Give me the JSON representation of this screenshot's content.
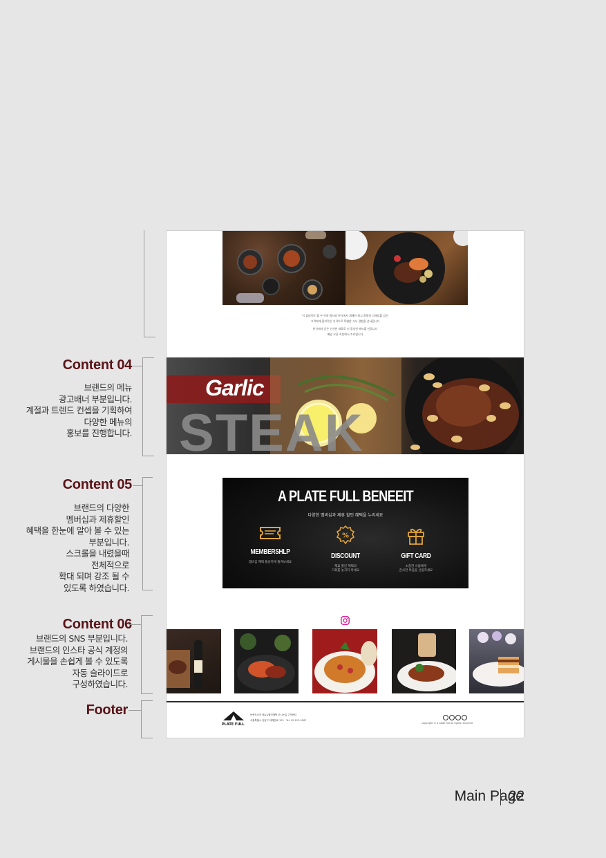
{
  "annotations": [
    {
      "title": "Content 04",
      "desc": "브랜드의 메뉴\n광고배너 부분입니다.\n계절과 트렌드 컨셉을 기획하여\n다양한 메뉴의\n홍보를 진행합니다."
    },
    {
      "title": "Content 05",
      "desc": "브랜드의 다양한\n멤버십과 제휴할인\n혜택을 한눈에 알아 볼 수 있는\n부분입니다.\n스크롤을 내렸을때\n전체적으로\n확대 되며 강조 될 수\n있도록 하였습니다."
    },
    {
      "title": "Content 06",
      "desc": "브랜드의 SNS 부분입니다.\n브랜드의 인스타 공식 계정의\n게시물을 손쉽게 볼 수 있도록\n자동 슬라이드로\n구성하였습니다."
    },
    {
      "title": "Footer",
      "desc": ""
    }
  ],
  "intro": {
    "lines": [
      "이 플레이트 풀 은 하와 협사와 한식에서 재해한 최고 품질의 식재료를 엄선",
      "고객에게 합리적인 가격으로 특별한 식사 경험을 선사합니다",
      "한식에서 얻은 신선한 재료로 더 풍성한 메뉴를 만듭니다",
      "매일 오픈 키친에서 조리됩니다"
    ]
  },
  "banner": {
    "word1": "Garlic",
    "word2": "STEAK"
  },
  "benefit": {
    "title": "A PLATE FULL BENEEIT",
    "subtitle": "다양한 멤버십과 제휴 할인 혜택을 누리세요",
    "items": [
      {
        "label": "MEMBERSHLP",
        "desc": "멤버십 혜택 통성하게 즐겨보세요",
        "icon": "ticket-icon"
      },
      {
        "label": "DISCOUNT",
        "desc": "제휴 할인 혜택의\n기회를 놓치지 마세요",
        "icon": "percent-badge-icon"
      },
      {
        "label": "GIFT CARD",
        "desc": "소중한 사람에게\n감사한 마음을 선물하세요",
        "icon": "gift-icon"
      }
    ]
  },
  "footer": {
    "logo_text": "PLATE FULL",
    "links": "브랜드소개    메뉴&할인혜택    오시는길    고객센터",
    "address": "서울특별시 강남구 테헤란로 123 · Tel. 02-123-4567",
    "copyright": "copyright © a plate full all rights reserved"
  },
  "page_label": "Main Page",
  "page_number": "22",
  "colors": {
    "accent": "#5a1418",
    "gold": "#e0a43a",
    "instagram": "#d6249f"
  }
}
